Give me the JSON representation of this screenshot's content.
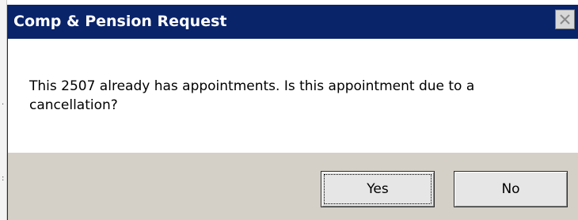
{
  "dialog": {
    "title": "Comp & Pension Request",
    "message": "This 2507 already has appointments. Is this appointment due to a cancellation?",
    "buttons": {
      "yes_label": "Yes",
      "no_label": "No"
    },
    "close_icon": "close-icon"
  },
  "colors": {
    "titlebar": "#0a246a",
    "title_text": "#ffffff",
    "button_bar": "#d4d0c8",
    "content_bg": "#ffffff"
  }
}
